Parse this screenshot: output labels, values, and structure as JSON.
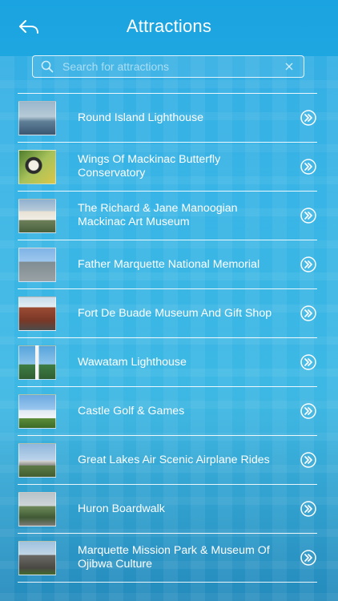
{
  "header": {
    "title": "Attractions"
  },
  "search": {
    "placeholder": "Search for attractions",
    "value": ""
  },
  "attractions": [
    {
      "name": "Round Island Lighthouse"
    },
    {
      "name": "Wings Of Mackinac Butterfly Conservatory"
    },
    {
      "name": "The Richard & Jane Manoogian Mackinac Art Museum"
    },
    {
      "name": "Father Marquette National Memorial"
    },
    {
      "name": "Fort De Buade Museum And Gift Shop"
    },
    {
      "name": "Wawatam Lighthouse"
    },
    {
      "name": "Castle Golf & Games"
    },
    {
      "name": "Great Lakes Air Scenic Airplane Rides"
    },
    {
      "name": "Huron Boardwalk"
    },
    {
      "name": "Marquette Mission Park & Museum Of Ojibwa Culture"
    }
  ],
  "icons": {
    "back": "back-arrow-icon",
    "search": "search-icon",
    "clear": "clear-icon",
    "row_action": "double-chevron-right-icon"
  },
  "colors": {
    "background": "#1aa3e0",
    "foreground": "#ffffff"
  }
}
